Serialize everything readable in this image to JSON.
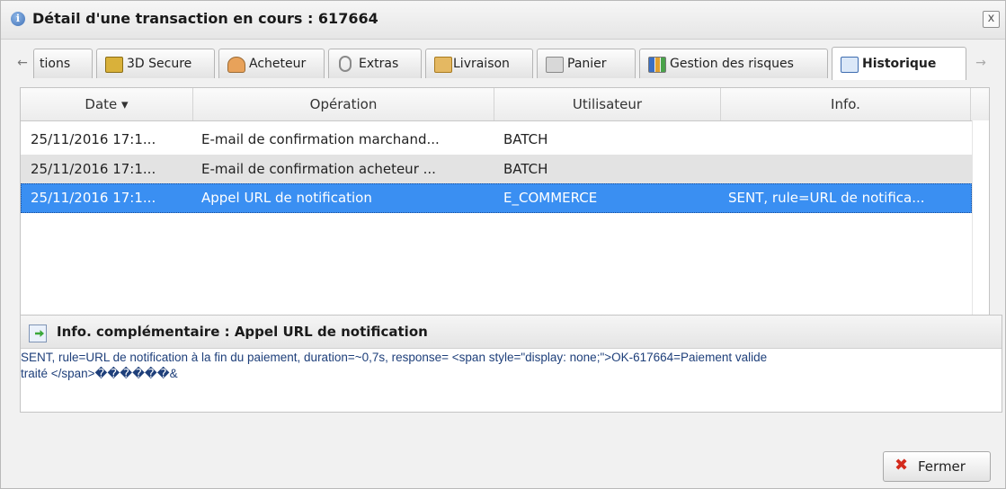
{
  "dialog": {
    "title": "Détail d'une transaction en cours : 617664",
    "close_label": "x"
  },
  "tabs": [
    {
      "label": "tions",
      "icon": "arrow-left-icon"
    },
    {
      "label": "3D Secure",
      "icon": "lock-3d-icon"
    },
    {
      "label": "Acheteur",
      "icon": "user-icon"
    },
    {
      "label": "Extras",
      "icon": "paperclip-icon"
    },
    {
      "label": "Livraison",
      "icon": "package-icon"
    },
    {
      "label": "Panier",
      "icon": "cart-icon"
    },
    {
      "label": "Gestion des risques",
      "icon": "chart-icon"
    },
    {
      "label": "Historique",
      "icon": "notebook-icon",
      "active": true
    }
  ],
  "grid": {
    "columns": [
      "Date ▾",
      "Opération",
      "Utilisateur",
      "Info."
    ],
    "rows": [
      {
        "date": "25/11/2016 17:1...",
        "operation": "E-mail de confirmation marchand...",
        "user": "BATCH",
        "info": ""
      },
      {
        "date": "25/11/2016 17:1...",
        "operation": "E-mail de confirmation acheteur ...",
        "user": "BATCH",
        "info": ""
      },
      {
        "date": "25/11/2016 17:1...",
        "operation": "Appel URL de notification",
        "user": "E_COMMERCE",
        "info": "SENT, rule=URL de notifica..."
      }
    ]
  },
  "info_panel": {
    "title": "Info. complémentaire : Appel URL de notification",
    "line1": "SENT, rule=URL de notification à la fin du paiement, duration=~0,7s, response= <span style=\"display: none;\">OK-617664=Paiement valide",
    "line2": "traité </span>������&"
  },
  "footer": {
    "close_button": "Fermer"
  },
  "colors": {
    "selection": "#3a8ff2",
    "info_text": "#1e3f7a",
    "close_x": "#d42a1c"
  }
}
